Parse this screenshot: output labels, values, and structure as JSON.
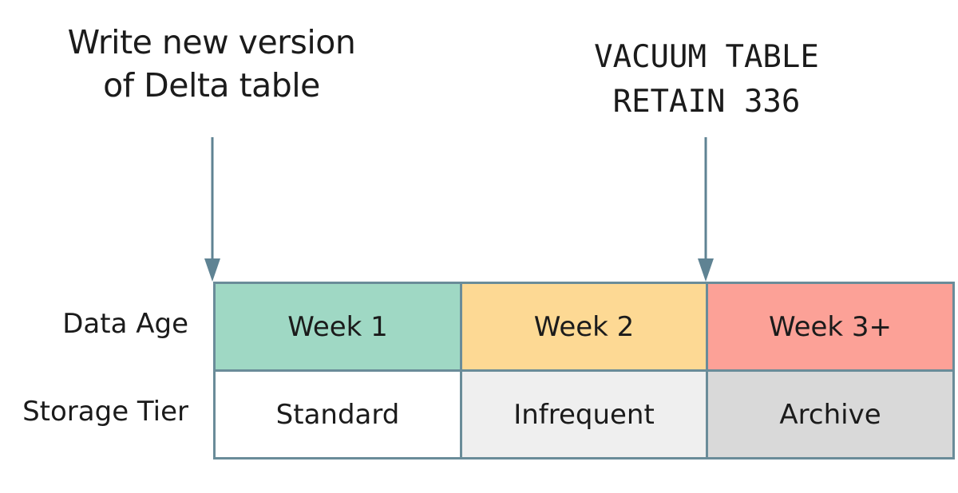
{
  "annotations": {
    "write": {
      "line1": "Write new version",
      "line2": "of Delta table"
    },
    "vacuum": {
      "line1": "VACUUM TABLE",
      "line2": "RETAIN 336"
    }
  },
  "row_labels": {
    "data_age": "Data Age",
    "storage_tier": "Storage Tier"
  },
  "columns": [
    {
      "age": "Week 1",
      "tier": "Standard",
      "age_color": "#9fd8c4",
      "tier_color": "#ffffff"
    },
    {
      "age": "Week 2",
      "tier": "Infrequent",
      "age_color": "#fdd994",
      "tier_color": "#efefef"
    },
    {
      "age": "Week 3+",
      "tier": "Archive",
      "age_color": "#fca197",
      "tier_color": "#d9d9d9"
    }
  ],
  "colors": {
    "border": "#6a8c99",
    "arrow": "#5f8393"
  }
}
